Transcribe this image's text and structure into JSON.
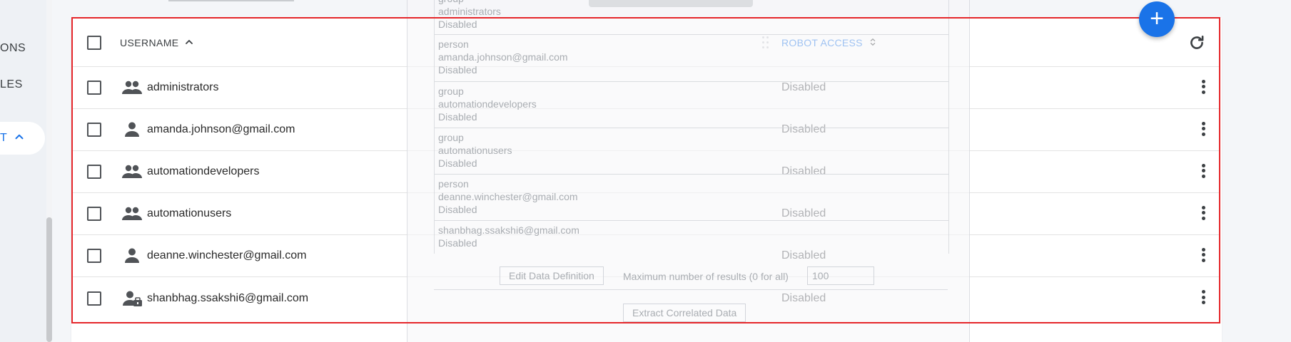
{
  "sidebar": {
    "items": [
      {
        "label": "ONS"
      },
      {
        "label": "LES"
      }
    ],
    "active_item": {
      "label": "T"
    }
  },
  "fab": {
    "label": "+"
  },
  "table": {
    "headers": {
      "username": "USERNAME",
      "robot_access": "ROBOT ACCESS"
    },
    "rows": [
      {
        "icon": "group-icon",
        "username": "administrators",
        "robot_access": "Disabled"
      },
      {
        "icon": "person-icon",
        "username": "amanda.johnson@gmail.com",
        "robot_access": "Disabled"
      },
      {
        "icon": "group-icon",
        "username": "automationdevelopers",
        "robot_access": "Disabled"
      },
      {
        "icon": "group-icon",
        "username": "automationusers",
        "robot_access": "Disabled"
      },
      {
        "icon": "person-icon",
        "username": "deanne.winchester@gmail.com",
        "robot_access": "Disabled"
      },
      {
        "icon": "person-key-icon",
        "username": "shanbhag.ssakshi6@gmail.com",
        "robot_access": "Disabled"
      }
    ]
  },
  "overlay": {
    "entries": [
      {
        "lines": [
          "group",
          "administrators",
          "Disabled"
        ]
      },
      {
        "lines": [
          "person",
          "amanda.johnson@gmail.com",
          "Disabled"
        ]
      },
      {
        "lines": [
          "group",
          "automationdevelopers",
          "Disabled"
        ]
      },
      {
        "lines": [
          "group",
          "automationusers",
          "Disabled"
        ]
      },
      {
        "lines": [
          "person",
          "deanne.winchester@gmail.com",
          "Disabled"
        ]
      },
      {
        "lines": [
          "shanbhag.ssakshi6@gmail.com",
          "Disabled"
        ]
      }
    ],
    "edit_button": "Edit Data Definition",
    "max_results_label": "Maximum number of results (0 for all)",
    "max_results_value": "100",
    "extract_button": "Extract Correlated Data"
  }
}
